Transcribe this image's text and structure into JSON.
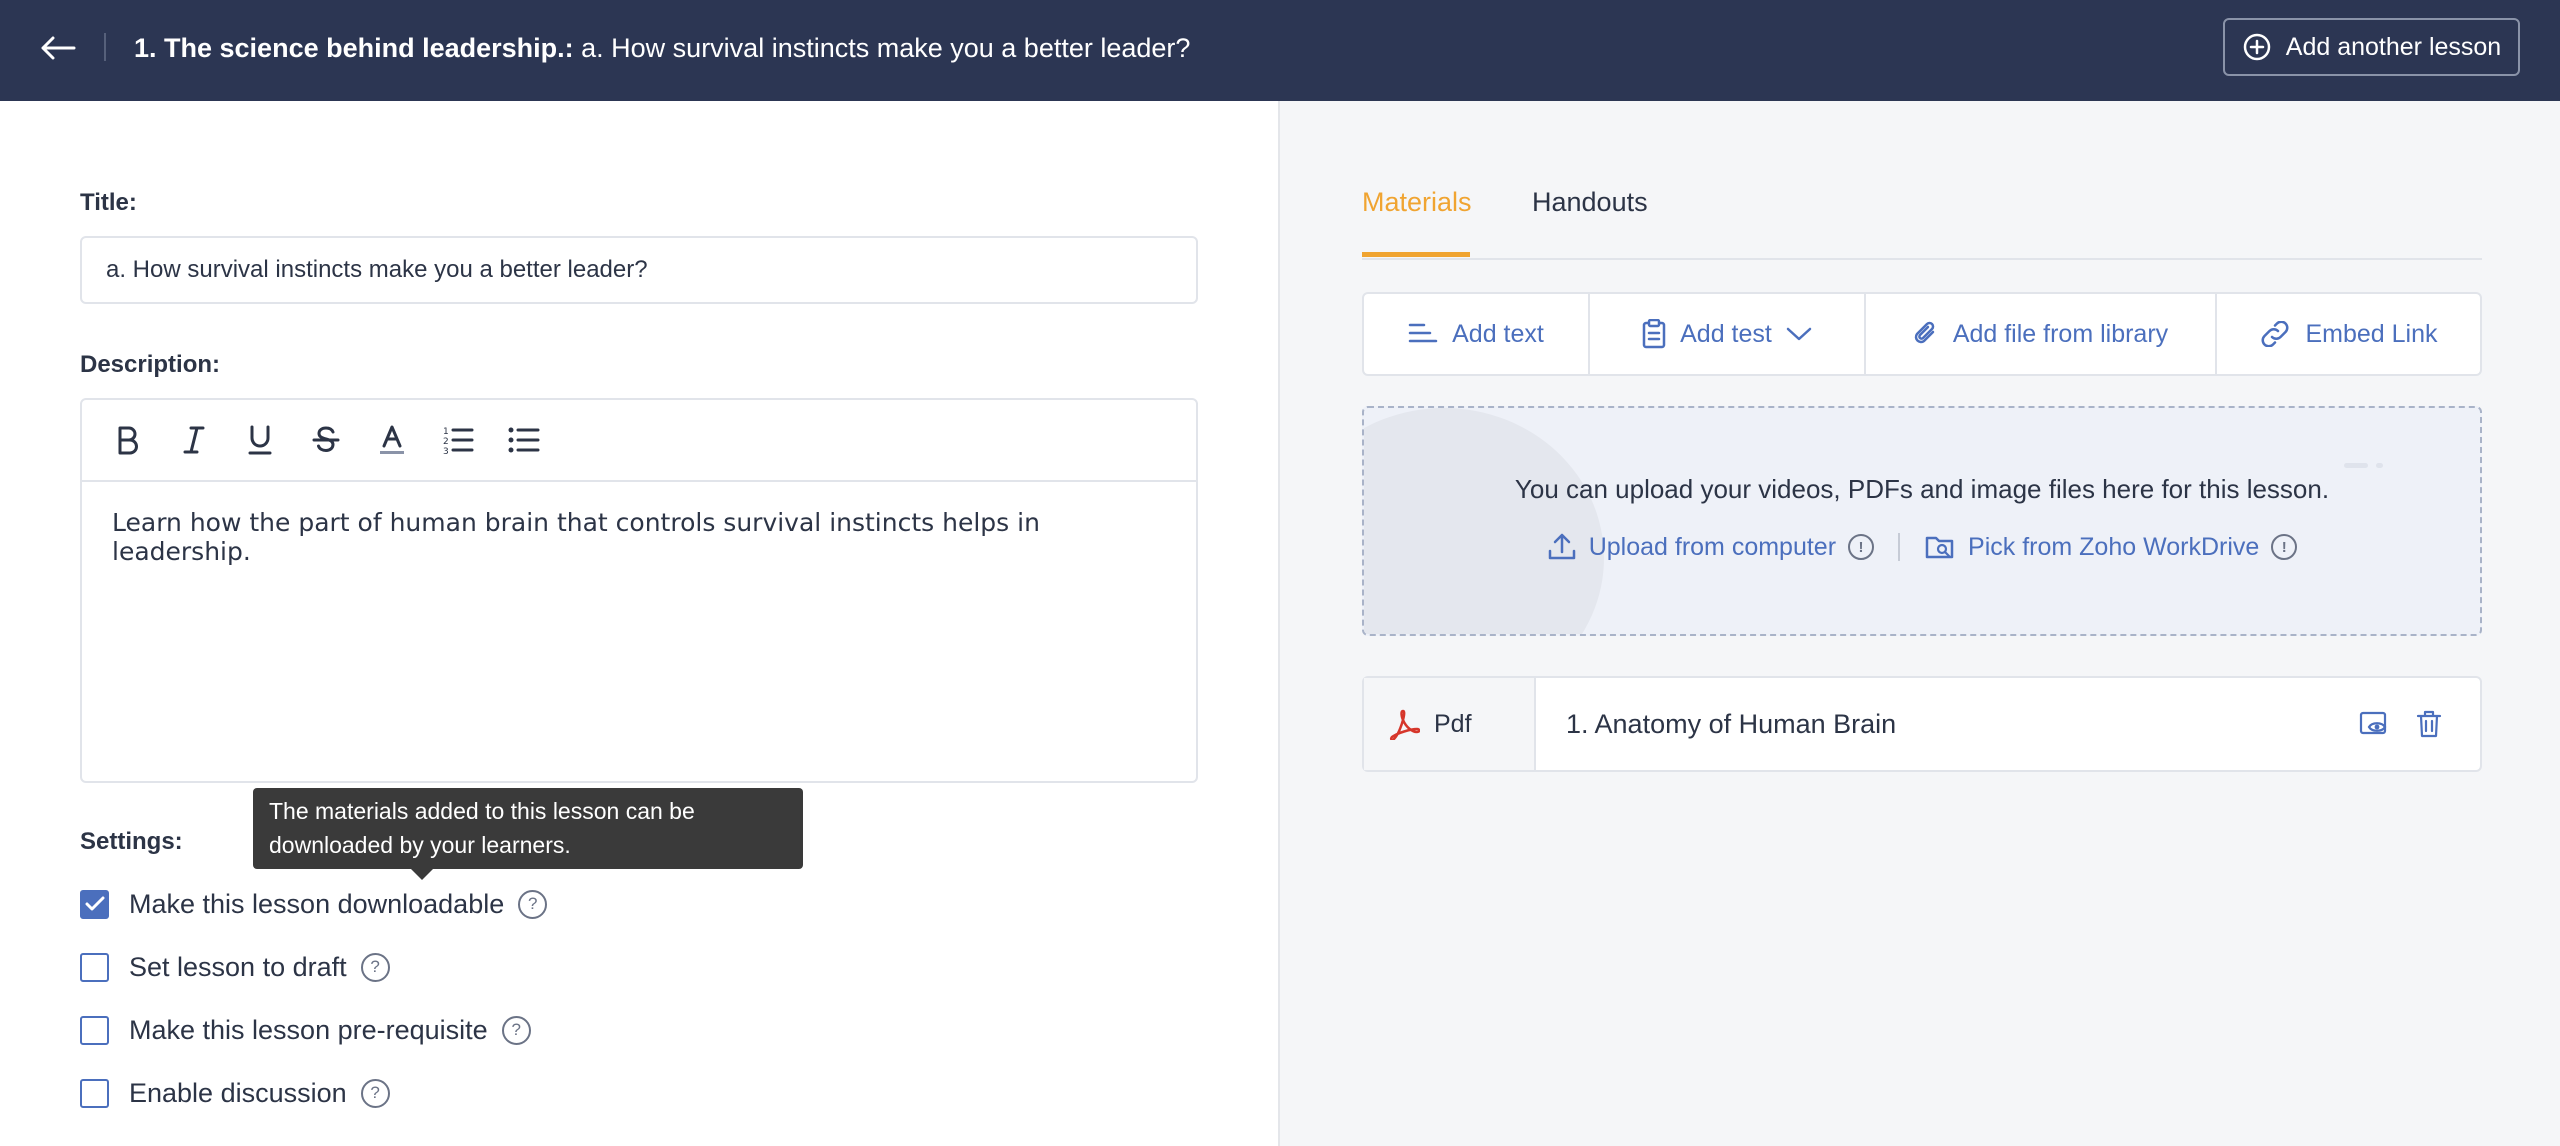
{
  "header": {
    "title_bold": "1. The science behind leadership.:",
    "title_rest": " a. How survival instincts make you a better leader?",
    "add_lesson_label": "Add another lesson"
  },
  "form": {
    "title_label": "Title:",
    "title_value": "a. How survival instincts make you a better leader?",
    "description_label": "Description:",
    "description_text": "Learn how the part of human brain that controls survival instincts helps in leadership.",
    "toolbar": [
      "bold",
      "italic",
      "underline",
      "strikethrough",
      "font-color",
      "numbered-list",
      "bulleted-list"
    ],
    "settings_label": "Settings:",
    "tooltip": "The materials added to this lesson can be downloaded by your learners.",
    "settings": [
      {
        "label": "Make this lesson downloadable",
        "checked": true
      },
      {
        "label": "Set lesson to draft",
        "checked": false
      },
      {
        "label": "Make this lesson pre-requisite",
        "checked": false
      },
      {
        "label": "Enable discussion",
        "checked": false
      }
    ]
  },
  "materials": {
    "tabs": [
      {
        "label": "Materials",
        "active": true
      },
      {
        "label": "Handouts",
        "active": false
      }
    ],
    "actions": {
      "add_text": "Add text",
      "add_test": "Add test",
      "add_file": "Add file from library",
      "embed_link": "Embed Link"
    },
    "dropzone": {
      "text": "You can upload your videos, PDFs and image files here for this lesson.",
      "upload_label": "Upload from computer",
      "workdrive_label": "Pick from Zoho WorkDrive"
    },
    "items": [
      {
        "type": "Pdf",
        "name": "1. Anatomy of Human Brain"
      }
    ]
  },
  "colors": {
    "header_bg": "#2c3653",
    "accent": "#f0a431",
    "link": "#4b6fbd",
    "pdf_red": "#d6362b"
  }
}
